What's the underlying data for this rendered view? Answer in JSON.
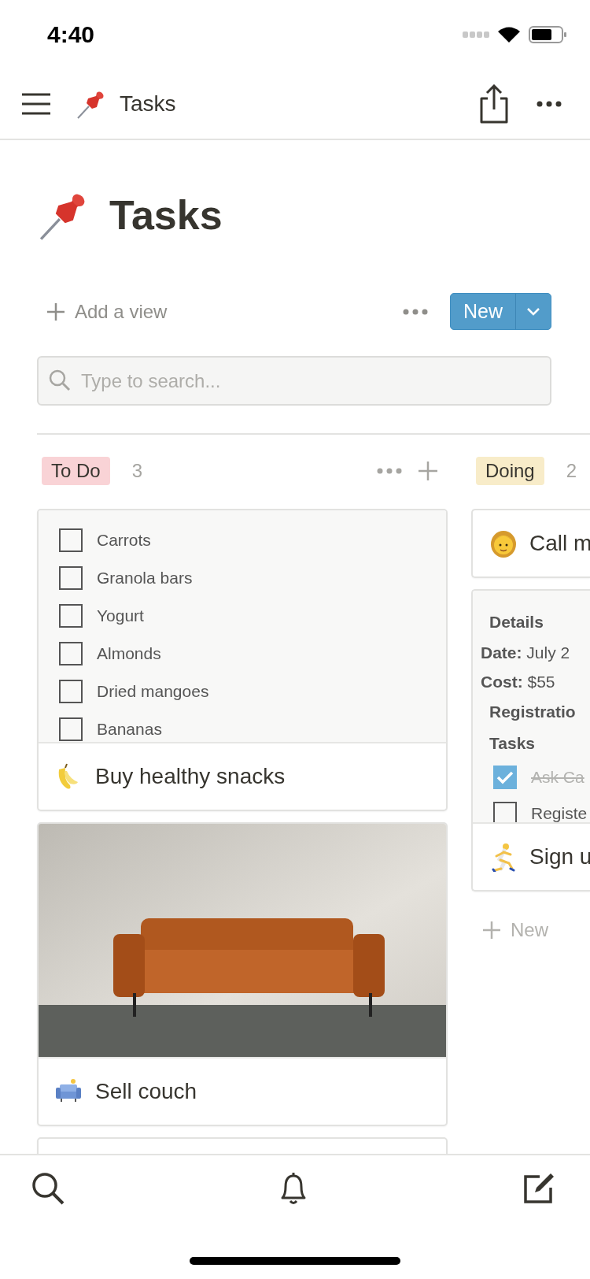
{
  "status_bar": {
    "time": "4:40"
  },
  "nav": {
    "title": "Tasks"
  },
  "page": {
    "title": "Tasks"
  },
  "toolbar": {
    "add_view": "Add a view",
    "new_button": "New"
  },
  "search": {
    "placeholder": "Type to search..."
  },
  "columns": [
    {
      "label": "To Do",
      "count": "3",
      "color": "#f9d3d6",
      "cards": [
        {
          "kind": "checklist",
          "title": "Buy healthy snacks",
          "items": [
            {
              "text": "Carrots",
              "checked": false
            },
            {
              "text": "Granola bars",
              "checked": false
            },
            {
              "text": "Yogurt",
              "checked": false
            },
            {
              "text": "Almonds",
              "checked": false
            },
            {
              "text": "Dried mangoes",
              "checked": false
            },
            {
              "text": "Bananas",
              "checked": false
            }
          ]
        },
        {
          "kind": "photo",
          "title": "Sell couch"
        },
        {
          "kind": "blank"
        }
      ]
    },
    {
      "label": "Doing",
      "count": "2",
      "color": "#f8ecc9",
      "new_label": "New",
      "cards": [
        {
          "kind": "title",
          "title": "Call m"
        },
        {
          "kind": "details",
          "title": "Sign u",
          "items": [
            {
              "kind": "heading",
              "text": "**Details**"
            },
            {
              "kind": "field",
              "text": "**Date:** July 2"
            },
            {
              "kind": "field",
              "text": "**Cost:** $55"
            },
            {
              "kind": "heading",
              "text": "**Registratio**"
            },
            {
              "kind": "heading",
              "text": "**Tasks**"
            },
            {
              "kind": "todo",
              "text": "Ask Ca",
              "checked": true
            },
            {
              "kind": "todo",
              "text": "Registe",
              "checked": false
            }
          ]
        }
      ]
    }
  ]
}
